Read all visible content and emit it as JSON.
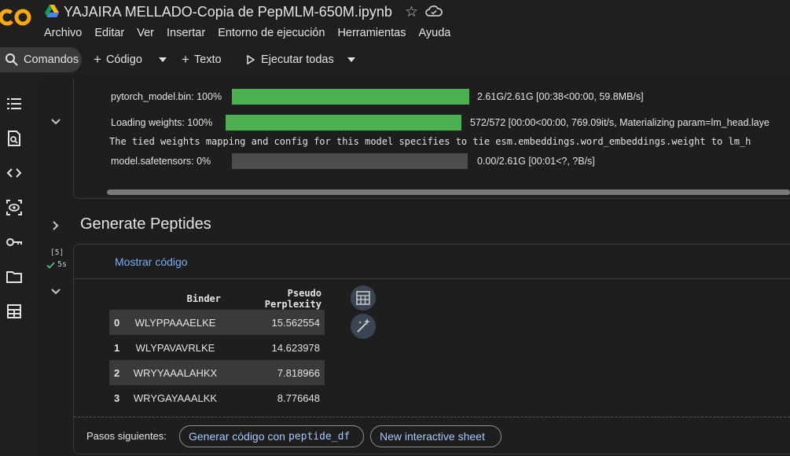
{
  "header": {
    "title": "YAJAIRA MELLADO-Copia de PepMLM-650M.ipynb",
    "menu": [
      "Archivo",
      "Editar",
      "Ver",
      "Insertar",
      "Entorno de ejecución",
      "Herramientas",
      "Ayuda"
    ]
  },
  "toolbar": {
    "commands": "Comandos",
    "code": "Código",
    "text": "Texto",
    "run_all": "Ejecutar todas"
  },
  "sidebar": {
    "icons": [
      "toc-icon",
      "search-replace-icon",
      "code-snippets-icon",
      "variables-icon",
      "secrets-key-icon",
      "files-folder-icon",
      "data-table-icon"
    ]
  },
  "output1": {
    "model_bin_label": "pytorch_model.bin:  100%",
    "model_bin_progress": 1.0,
    "model_bin_stats": "2.61G/2.61G [00:38<00:00, 59.8MB/s]",
    "loading_label": "Loading weights:  100%",
    "loading_progress": 1.0,
    "loading_stats": "572/572 [00:00<00:00, 769.09it/s, Materializing param=lm_head.laye",
    "tied_weights_text": "The tied weights mapping and config for this model specifies to tie esm.embeddings.word_embeddings.weight to lm_h",
    "safetensors_label": "model.safetensors:    0%",
    "safetensors_progress": 0.0,
    "safetensors_stats": "0.00/2.61G [00:01<?, ?B/s]"
  },
  "section": {
    "title": "Generate Peptides"
  },
  "cell2": {
    "exec_count": "[5]",
    "exec_time": "5s",
    "show_code": "Mostrar código",
    "table": {
      "columns": [
        "",
        "Binder",
        "Pseudo Perplexity"
      ],
      "rows": [
        {
          "index": "0",
          "binder": "WLYPPAAAELKE",
          "perplexity": "15.562554"
        },
        {
          "index": "1",
          "binder": "WLYPAVAVRLKE",
          "perplexity": "14.623978"
        },
        {
          "index": "2",
          "binder": "WRYYAAALAHKX",
          "perplexity": "7.818966"
        },
        {
          "index": "3",
          "binder": "WRYGAYAAALKK",
          "perplexity": "8.776648"
        }
      ]
    },
    "next_steps_label": "Pasos siguientes:",
    "generate_code_label": "Generar código con",
    "generate_code_var": "peptide_df",
    "interactive_sheet_label": "New interactive sheet"
  },
  "colors": {
    "background": "#1f1f1f",
    "progress_fill": "#4caf50",
    "link": "#7cacf8",
    "chip_text": "#a8c7fa"
  }
}
